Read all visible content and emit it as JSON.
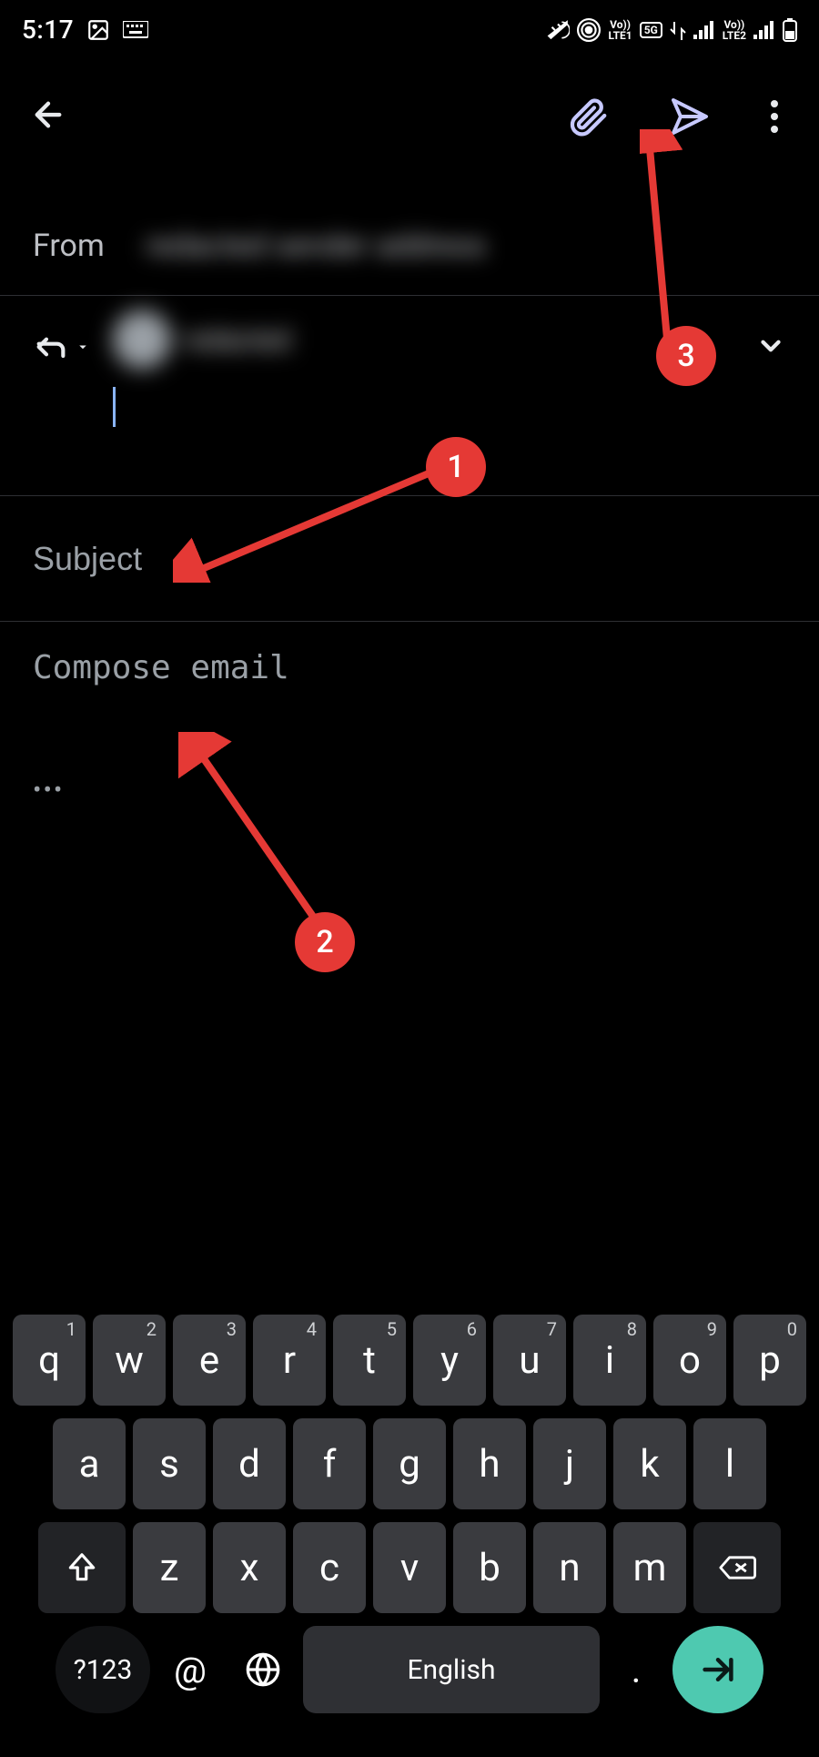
{
  "status": {
    "time": "5:17",
    "lte1": "LTE1",
    "lte2": "LTE2",
    "fiveg": "5G"
  },
  "actions": {
    "back": "back",
    "attach": "attach",
    "send": "send",
    "more": "more"
  },
  "compose": {
    "from_label": "From",
    "from_value": "redacted sender address",
    "recipient_name": "redacted",
    "subject_placeholder": "Subject",
    "body_placeholder": "Compose email",
    "collapsed": "•••"
  },
  "annotations": {
    "a1": "1",
    "a2": "2",
    "a3": "3"
  },
  "keyboard": {
    "row1": [
      {
        "main": "q",
        "sup": "1"
      },
      {
        "main": "w",
        "sup": "2"
      },
      {
        "main": "e",
        "sup": "3"
      },
      {
        "main": "r",
        "sup": "4"
      },
      {
        "main": "t",
        "sup": "5"
      },
      {
        "main": "y",
        "sup": "6"
      },
      {
        "main": "u",
        "sup": "7"
      },
      {
        "main": "i",
        "sup": "8"
      },
      {
        "main": "o",
        "sup": "9"
      },
      {
        "main": "p",
        "sup": "0"
      }
    ],
    "row2": [
      "a",
      "s",
      "d",
      "f",
      "g",
      "h",
      "j",
      "k",
      "l"
    ],
    "row3": [
      "z",
      "x",
      "c",
      "v",
      "b",
      "n",
      "m"
    ],
    "sym": "?123",
    "at": "@",
    "space": "English",
    "period": "."
  }
}
